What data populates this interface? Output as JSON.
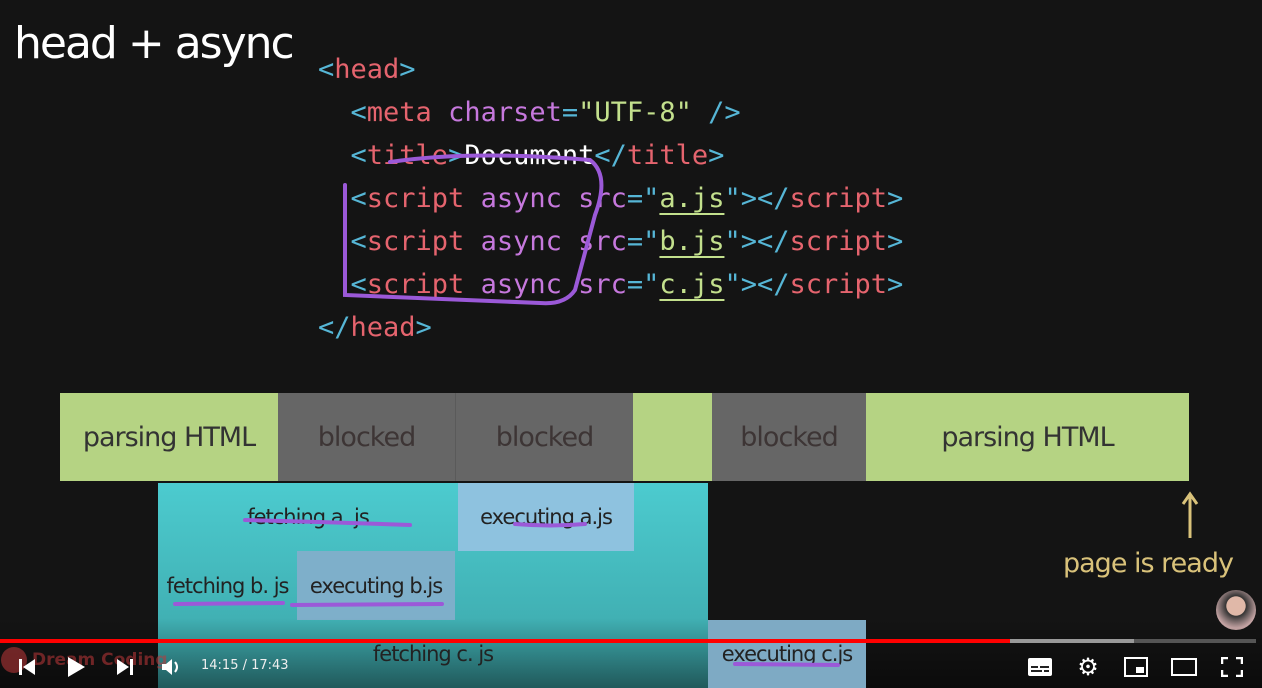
{
  "slide": {
    "title": "head + async",
    "code": {
      "l1": [
        "<",
        "head",
        ">"
      ],
      "l2": [
        "<",
        "meta",
        " charset",
        "=",
        "\"UTF-8\"",
        " />"
      ],
      "l3": [
        "<",
        "title",
        ">",
        "Document",
        "</",
        "title",
        ">"
      ],
      "scripts": [
        {
          "file": "a.js"
        },
        {
          "file": "b.js"
        },
        {
          "file": "c.js"
        }
      ],
      "kw": {
        "lt": "<",
        "script": "script",
        "async": " async",
        "src": " src",
        "eq": "=\"",
        "close": "\">",
        "endlt": "</",
        "gt": ">"
      },
      "l7": [
        "</",
        "head",
        ">"
      ]
    },
    "timeline": {
      "parse1": "parsing HTML",
      "blocked1": "blocked",
      "blocked2": "blocked",
      "blocked3": "blocked",
      "parse2": "parsing HTML",
      "fetch_a": "fetching a. js",
      "exec_a": "executing a.js",
      "fetch_b": "fetching b. js",
      "exec_b": "executing b.js",
      "fetch_c": "fetching c. js",
      "exec_c": "executing c.js"
    },
    "ready_label": "page is ready"
  },
  "player": {
    "current_time": "14:15",
    "duration": "17:43",
    "time_text": "14:15 / 17:43",
    "played_fraction": 0.804,
    "buffered_fraction": 0.903,
    "channel": "Dream Coding",
    "icons": [
      "previous-icon",
      "play-icon",
      "next-icon",
      "volume-icon",
      "subtitles-icon",
      "settings-icon",
      "miniplayer-icon",
      "theater-mode-icon",
      "fullscreen-icon"
    ],
    "accent": "#ff0000"
  }
}
